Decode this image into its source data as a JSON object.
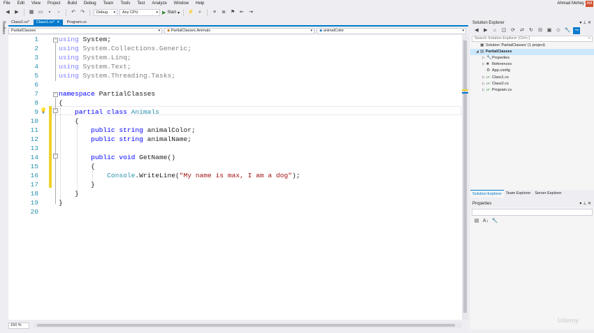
{
  "menu": [
    "File",
    "Edit",
    "View",
    "Project",
    "Build",
    "Debug",
    "Team",
    "Tools",
    "Test",
    "Analyze",
    "Window",
    "Help"
  ],
  "user": {
    "name": "Ahmad Mohey",
    "initials": "AM"
  },
  "toolbar": {
    "config": "Debug",
    "platform": "Any CPU",
    "start_label": "Start"
  },
  "left_strip": {
    "label": "Toolbox"
  },
  "tabs": [
    {
      "label": "Class2.cs*",
      "active": false
    },
    {
      "label": "Class1.cs*",
      "active": true,
      "close": "✕"
    },
    {
      "label": "Program.cs",
      "active": false
    }
  ],
  "nav": {
    "project": "PartialClasses",
    "type": "PartialClasses.Animals",
    "member": "animalColor"
  },
  "code_lines": [
    [
      {
        "t": "using ",
        "c": "kwdim"
      },
      {
        "t": "System;",
        "c": "plain"
      }
    ],
    [
      {
        "t": "using ",
        "c": "kwdim"
      },
      {
        "t": "System.Collections.Generic;",
        "c": "dim"
      }
    ],
    [
      {
        "t": "using ",
        "c": "kwdim"
      },
      {
        "t": "System.Linq;",
        "c": "dim"
      }
    ],
    [
      {
        "t": "using ",
        "c": "kwdim"
      },
      {
        "t": "System.Text;",
        "c": "dim"
      }
    ],
    [
      {
        "t": "using ",
        "c": "kwdim"
      },
      {
        "t": "System.Threading.Tasks;",
        "c": "dim"
      }
    ],
    [],
    [
      {
        "t": "namespace ",
        "c": "kw"
      },
      {
        "t": "PartialClasses",
        "c": "plain"
      }
    ],
    [
      {
        "t": "{",
        "c": "plain"
      }
    ],
    [
      {
        "t": "    partial class ",
        "c": "kw"
      },
      {
        "t": "Animals",
        "c": "ty"
      }
    ],
    [
      {
        "t": "    {",
        "c": "plain"
      }
    ],
    [
      {
        "t": "        public string ",
        "c": "kw"
      },
      {
        "t": "animalColor;",
        "c": "plain"
      }
    ],
    [
      {
        "t": "        public string ",
        "c": "kw"
      },
      {
        "t": "animalName;",
        "c": "plain"
      }
    ],
    [],
    [
      {
        "t": "        public void ",
        "c": "kw"
      },
      {
        "t": "GetName()",
        "c": "plain"
      }
    ],
    [
      {
        "t": "        {",
        "c": "plain"
      }
    ],
    [
      {
        "t": "            Console",
        "c": "ty"
      },
      {
        "t": ".WriteLine(",
        "c": "plain"
      },
      {
        "t": "\"My name is max, I am a dog\"",
        "c": "str"
      },
      {
        "t": ");",
        "c": "plain"
      }
    ],
    [
      {
        "t": "        }",
        "c": "plain"
      }
    ],
    [
      {
        "t": "    }",
        "c": "plain"
      }
    ],
    [
      {
        "t": "}",
        "c": "plain"
      }
    ],
    []
  ],
  "zoom": "150 %",
  "solution_explorer": {
    "title": "Solution Explorer",
    "search_placeholder": "Search Solution Explorer (Ctrl+;)",
    "items": [
      {
        "label": "Solution 'PartialClasses' (1 project)",
        "indent": 0,
        "icon": "solution-icon",
        "glyph": "▣",
        "exp": ""
      },
      {
        "label": "PartialClasses",
        "indent": 0,
        "icon": "csharp-project-icon",
        "glyph": "▤",
        "exp": "◢",
        "selected": true
      },
      {
        "label": "Properties",
        "indent": 1,
        "icon": "wrench-icon",
        "glyph": "🔧",
        "exp": "▷"
      },
      {
        "label": "References",
        "indent": 1,
        "icon": "references-icon",
        "glyph": "■",
        "exp": "▷"
      },
      {
        "label": "App.config",
        "indent": 1,
        "icon": "config-file-icon",
        "glyph": "⚙",
        "exp": ""
      },
      {
        "label": "Class1.cs",
        "indent": 1,
        "icon": "csharp-file-icon",
        "glyph": "c#",
        "exp": "▷"
      },
      {
        "label": "Class2.cs",
        "indent": 1,
        "icon": "csharp-file-icon",
        "glyph": "c#",
        "exp": "▷"
      },
      {
        "label": "Program.cs",
        "indent": 1,
        "icon": "csharp-file-icon",
        "glyph": "c#",
        "exp": "▷"
      }
    ],
    "tabs": [
      {
        "label": "Solution Explorer",
        "active": true
      },
      {
        "label": "Team Explorer",
        "active": false
      },
      {
        "label": "Server Explorer",
        "active": false
      }
    ]
  },
  "properties": {
    "title": "Properties"
  },
  "watermark": "Udemy",
  "colors": {
    "accent": "#007acc",
    "keyword": "#0000ff",
    "type": "#2b91af",
    "string": "#a31515",
    "changed": "#efd12c"
  }
}
